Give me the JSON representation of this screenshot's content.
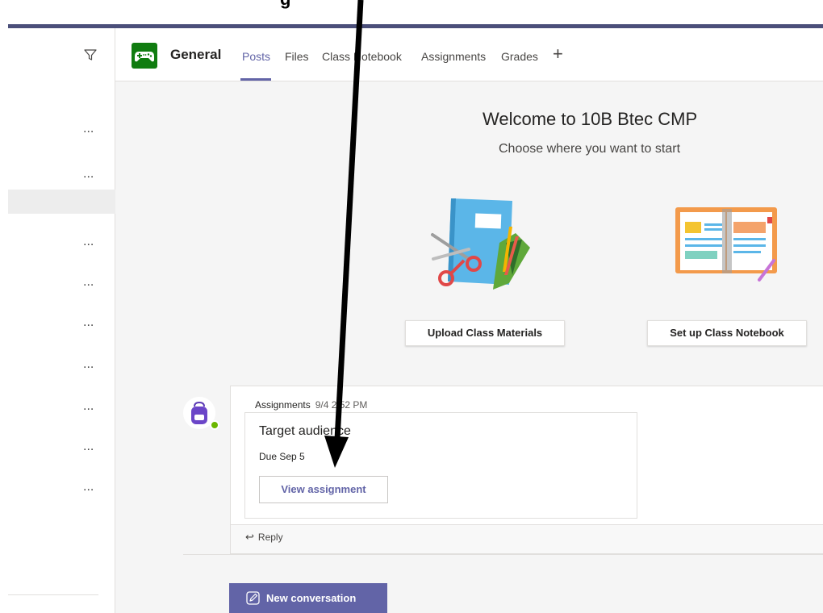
{
  "header": {
    "channel_name": "General",
    "tabs": [
      {
        "label": "Posts"
      },
      {
        "label": "Files"
      },
      {
        "label": "Class Notebook"
      },
      {
        "label": "Assignments"
      },
      {
        "label": "Grades"
      }
    ],
    "add_tab_label": "+"
  },
  "welcome": {
    "title": "Welcome to 10B Btec CMP",
    "subtitle": "Choose where you want to start",
    "upload_button": "Upload Class Materials",
    "notebook_button": "Set up Class Notebook"
  },
  "post": {
    "author": "Assignments",
    "time": "9/4 2:52 PM",
    "assignment_title": "Target audience",
    "due": "Due Sep 5",
    "view_button": "View assignment",
    "reply_label": "Reply"
  },
  "composer": {
    "new_conversation_label": "New conversation"
  },
  "annotation": {
    "caption": "g"
  },
  "left": {
    "more_label": "..."
  },
  "colors": {
    "accent": "#6264a7",
    "team_avatar": "#107c10",
    "top_bar": "#4b4f7a",
    "presence": "#6bb700"
  }
}
